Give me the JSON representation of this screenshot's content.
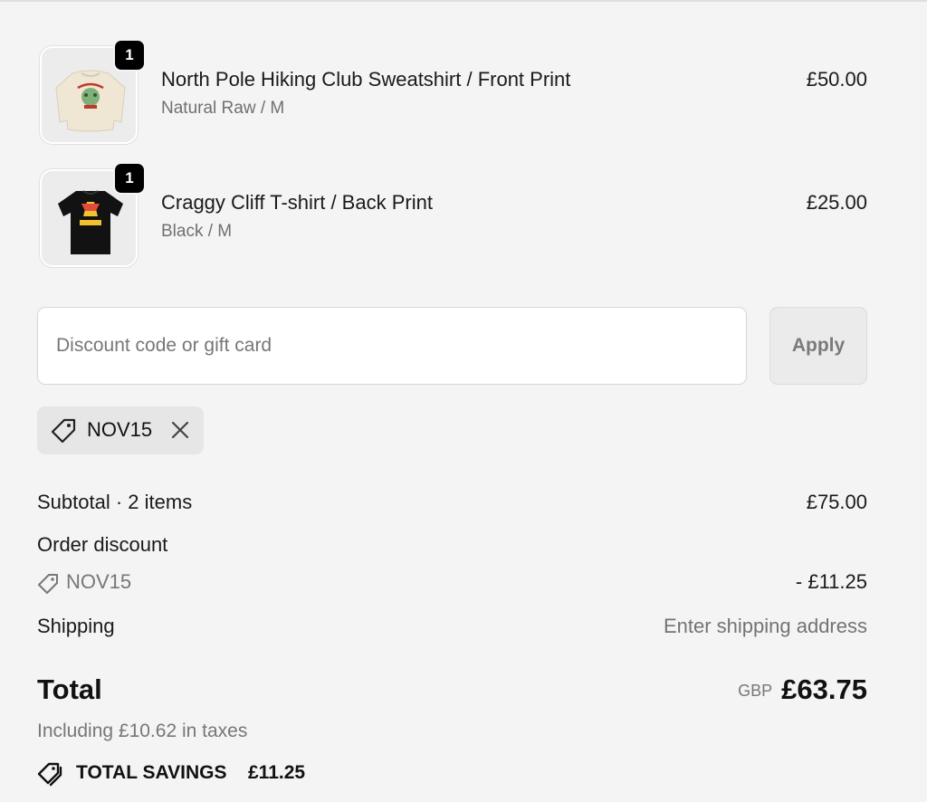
{
  "cart": {
    "items": [
      {
        "name": "North Pole Hiking Club Sweatshirt / Front Print",
        "variant": "Natural Raw / M",
        "price": "£50.00",
        "quantity": "1",
        "image_icon": "sweatshirt-image"
      },
      {
        "name": "Craggy Cliff T-shirt / Back Print",
        "variant": "Black / M",
        "price": "£25.00",
        "quantity": "1",
        "image_icon": "tshirt-image"
      }
    ]
  },
  "discount": {
    "placeholder": "Discount code or gift card",
    "value": "",
    "apply_label": "Apply",
    "applied_code": "NOV15"
  },
  "summary": {
    "subtotal_label": "Subtotal · 2 items",
    "subtotal_value": "£75.00",
    "order_discount_label": "Order discount",
    "discount_code": "NOV15",
    "discount_value": "- £11.25",
    "shipping_label": "Shipping",
    "shipping_value": "Enter shipping address",
    "total_label": "Total",
    "currency": "GBP",
    "total_value": "£63.75",
    "taxes_note": "Including £10.62 in taxes",
    "savings_label": "TOTAL SAVINGS",
    "savings_value": "£11.25"
  },
  "colors": {
    "background": "#f4f4f4",
    "badge": "#000000",
    "muted_text": "#737373",
    "chip_background": "#e6e6e6"
  }
}
